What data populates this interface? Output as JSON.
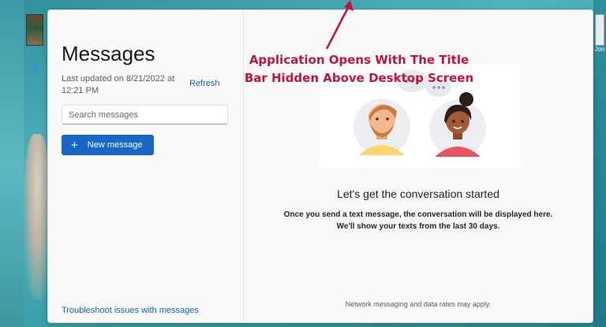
{
  "app": {
    "title": "Messages",
    "last_updated": "Last updated on 8/21/2022 at 12:21 PM",
    "refresh_label": "Refresh",
    "search_placeholder": "Search messages",
    "new_message_label": "New message",
    "troubleshoot_label": "Troubleshoot issues with messages"
  },
  "conversation": {
    "heading": "Let's get the conversation started",
    "description_line1": "Once you send a text message, the conversation will be displayed here.",
    "description_line2": "We'll show your texts from the last 30 days.",
    "footer_note": "Network messaging and data rates may apply."
  },
  "annotation": {
    "line1": "Application Opens With The Title",
    "line2": "Bar Hidden Above Desktop Screen"
  },
  "desktop": {
    "left_app_icon": "google-icon",
    "google_glyph": "G",
    "right_label": "Jon"
  },
  "colors": {
    "accent": "#1667c7",
    "link": "#0f63c5",
    "annotation": "#c5143b",
    "desktop": "#3aa2ad"
  }
}
